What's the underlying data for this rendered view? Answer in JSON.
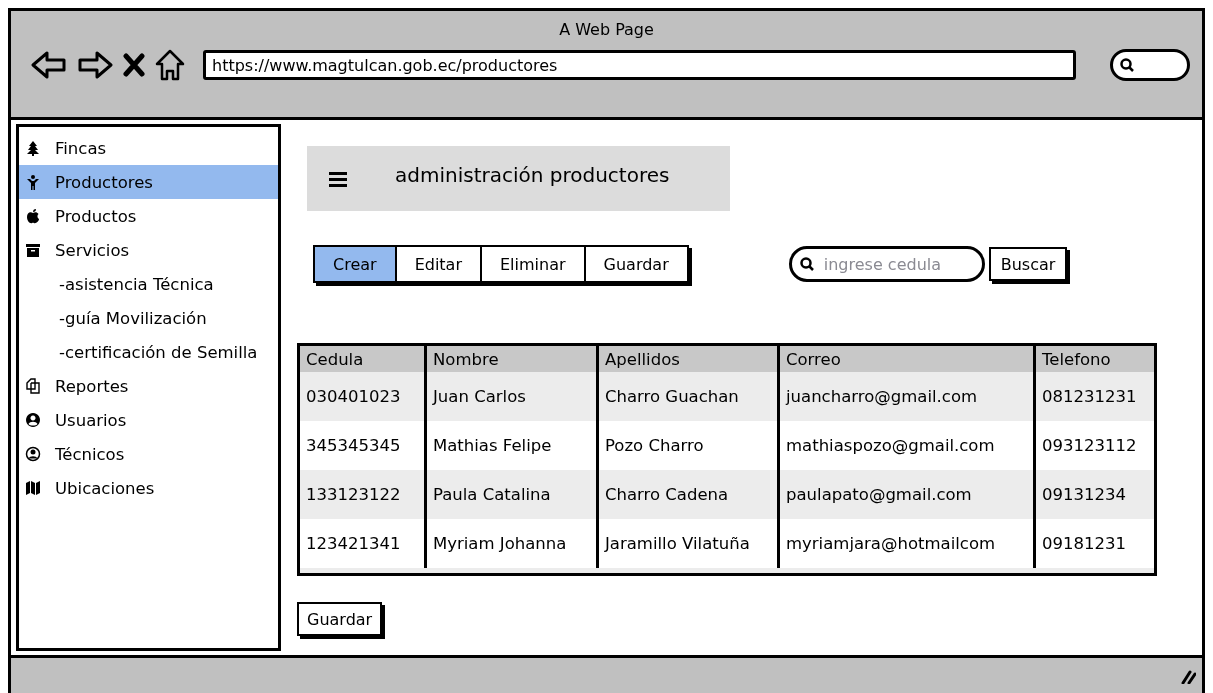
{
  "window": {
    "title": "A Web Page",
    "url": "https://www.magtulcan.gob.ec/productores"
  },
  "sidebar": {
    "items": [
      {
        "label": "Fincas",
        "selected": false
      },
      {
        "label": "Productores",
        "selected": true
      },
      {
        "label": "Productos",
        "selected": false
      },
      {
        "label": "Servicios",
        "selected": false,
        "children": [
          {
            "label": "-asistencia Técnica"
          },
          {
            "label": "-guía Movilización"
          },
          {
            "label": "-certificación de Semilla"
          }
        ]
      },
      {
        "label": "Reportes",
        "selected": false
      },
      {
        "label": "Usuarios",
        "selected": false
      },
      {
        "label": "Técnicos",
        "selected": false
      },
      {
        "label": "Ubicaciones",
        "selected": false
      }
    ]
  },
  "header": {
    "title": "administración productores"
  },
  "toolbar": [
    {
      "label": "Crear",
      "selected": true
    },
    {
      "label": "Editar",
      "selected": false
    },
    {
      "label": "Eliminar",
      "selected": false
    },
    {
      "label": "Guardar",
      "selected": false
    }
  ],
  "search": {
    "placeholder": "ingrese cedula",
    "button": "Buscar"
  },
  "table": {
    "columns": [
      "Cedula",
      "Nombre",
      "Apellidos",
      "Correo",
      "Telefono"
    ],
    "rows": [
      [
        "030401023",
        "Juan Carlos",
        "Charro Guachan",
        "juancharro@gmail.com",
        "081231231"
      ],
      [
        "345345345",
        "Mathias Felipe",
        "Pozo Charro",
        "mathiaspozo@gmail.com",
        "093123112"
      ],
      [
        "133123122",
        "Paula Catalina",
        "Charro Cadena",
        "paulapato@gmail.com",
        "09131234"
      ],
      [
        "123421341",
        "Myriam Johanna",
        "Jaramillo Vilatuña",
        "myriamjara@hotmailcom",
        "09181231"
      ]
    ]
  },
  "save_button": "Guardar"
}
